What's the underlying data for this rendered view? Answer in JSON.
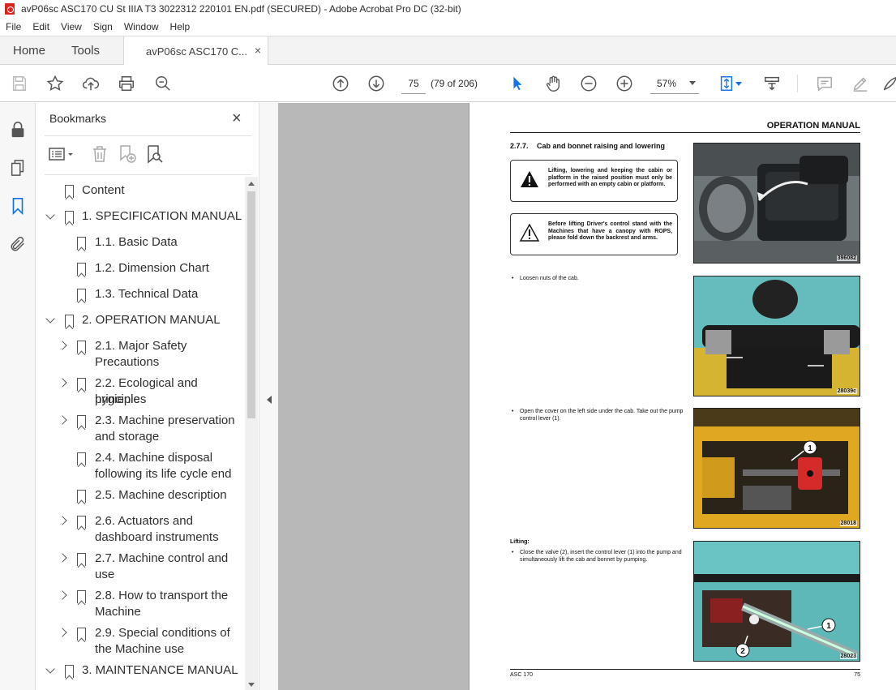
{
  "window": {
    "title": "avP06sc ASC170 CU St IIIA T3 3022312 220101 EN.pdf (SECURED) - Adobe Acrobat Pro DC (32-bit)"
  },
  "menu": [
    "File",
    "Edit",
    "View",
    "Sign",
    "Window",
    "Help"
  ],
  "tabs": {
    "home": "Home",
    "tools": "Tools",
    "doc": "avP06sc ASC170 C...",
    "close": "×"
  },
  "toolbar": {
    "page_number": "75",
    "page_count": "(79 of 206)",
    "zoom": "57%"
  },
  "bookmarks": {
    "title": "Bookmarks",
    "close": "×",
    "items": [
      {
        "label": "Content",
        "level": 0,
        "expander": "none"
      },
      {
        "label": "1. SPECIFICATION MANUAL",
        "level": 0,
        "expander": "down"
      },
      {
        "label": "1.1. Basic Data",
        "level": 1,
        "expander": "none"
      },
      {
        "label": "1.2. Dimension Chart",
        "level": 1,
        "expander": "none"
      },
      {
        "label": "1.3. Technical Data",
        "level": 1,
        "expander": "none"
      },
      {
        "label": "2. OPERATION MANUAL",
        "level": 0,
        "expander": "down"
      },
      {
        "label": "2.1. Major Safety Precautions",
        "line1": "2.1. Major Safety",
        "line2": "Precautions",
        "level": 1,
        "expander": "right"
      },
      {
        "label": "2.2. Ecological and hygienic principles",
        "line1": "2.2. Ecological and hygienic",
        "line2": "principles",
        "level": 1,
        "expander": "right"
      },
      {
        "label": "2.3. Machine preservation and storage",
        "line1": "2.3. Machine preservation",
        "line2": "and storage",
        "level": 1,
        "expander": "right"
      },
      {
        "label": "2.4. Machine disposal following its life cycle end",
        "line1": "2.4. Machine disposal",
        "line2": "following its life cycle end",
        "level": 1,
        "expander": "none"
      },
      {
        "label": "2.5. Machine description",
        "level": 1,
        "expander": "none"
      },
      {
        "label": "2.6. Actuators and dashboard instruments",
        "line1": "2.6. Actuators and",
        "line2": "dashboard instruments",
        "level": 1,
        "expander": "right"
      },
      {
        "label": "2.7. Machine control and use",
        "line1": "2.7. Machine control and",
        "line2": "use",
        "level": 1,
        "expander": "right"
      },
      {
        "label": "2.8. How to transport the Machine",
        "line1": "2.8. How to transport the",
        "line2": "Machine",
        "level": 1,
        "expander": "right"
      },
      {
        "label": "2.9. Special conditions of the Machine use",
        "line1": "2.9. Special conditions of",
        "line2": "the Machine use",
        "level": 1,
        "expander": "right"
      },
      {
        "label": "3. MAINTENANCE MANUAL",
        "level": 0,
        "expander": "down"
      }
    ]
  },
  "pdf_page": {
    "header": "OPERATION MANUAL",
    "section_number": "2.7.7.",
    "section_title": "Cab and bonnet raising and lowering",
    "warning1": "Lifting, lowering and keeping the cabin or platform in the raised position must only be performed with an empty cabin or platform.",
    "warning2": "Before lifting Driver's control stand with the Machines that have a canopy with ROPS, please fold down the backrest and arms.",
    "step1": "Loosen nuts of the cab.",
    "step2": "Open the cover on the left side under the cab. Take out the pump control lever (1).",
    "lifting_label": "Lifting:",
    "step3": "Close the valve (2), insert the control lever (1) into the pump and simultaneously lift the cab and bonnet by pumping.",
    "photo_codes": [
      "396082",
      "28039c",
      "28018",
      "28023"
    ],
    "callouts": [
      "1",
      "1",
      "2"
    ],
    "footer_left": "ASC 170",
    "footer_right": "75"
  },
  "colors": {
    "acrobat_red": "#d8261f",
    "accent_blue": "#1473e6",
    "photo_teal": "#5fb8b8",
    "photo_yellow": "#e0a820"
  }
}
